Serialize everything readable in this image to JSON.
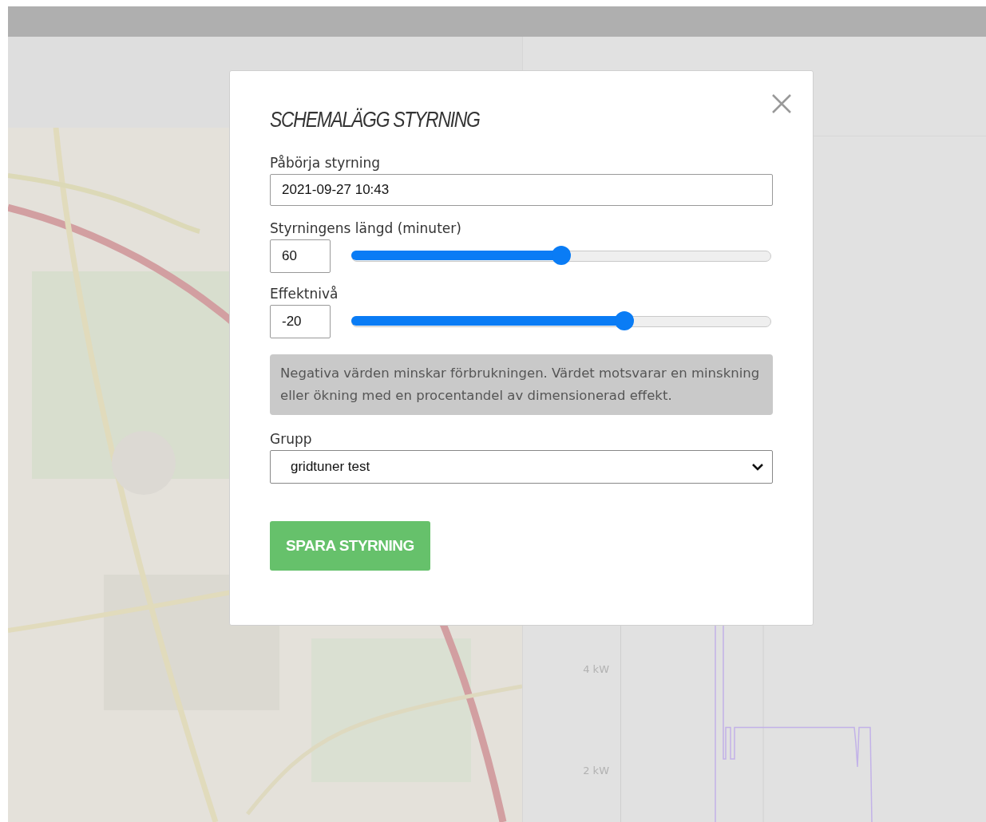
{
  "background": {
    "chart": {
      "y_tick_labels": [
        "4 kW",
        "2 kW"
      ]
    }
  },
  "dialog": {
    "title": "SCHEMALÄGG STYRNING",
    "start": {
      "label": "Påbörja styrning",
      "value": "2021-09-27 10:43"
    },
    "sliders": [
      {
        "label": "Styrningens längd (minuter)",
        "value": "60",
        "level": 0.5
      },
      {
        "label": "Effektnivå",
        "value": "-20",
        "level": 0.65
      }
    ],
    "info": "Negativa värden minskar förbrukningen. Värdet motsvarar en minskning eller ökning med en procentandel av dimensionerad effekt.",
    "group": {
      "label": "Grupp",
      "value": "gridtuner test"
    },
    "save_button": "SPARA STYRNING"
  }
}
